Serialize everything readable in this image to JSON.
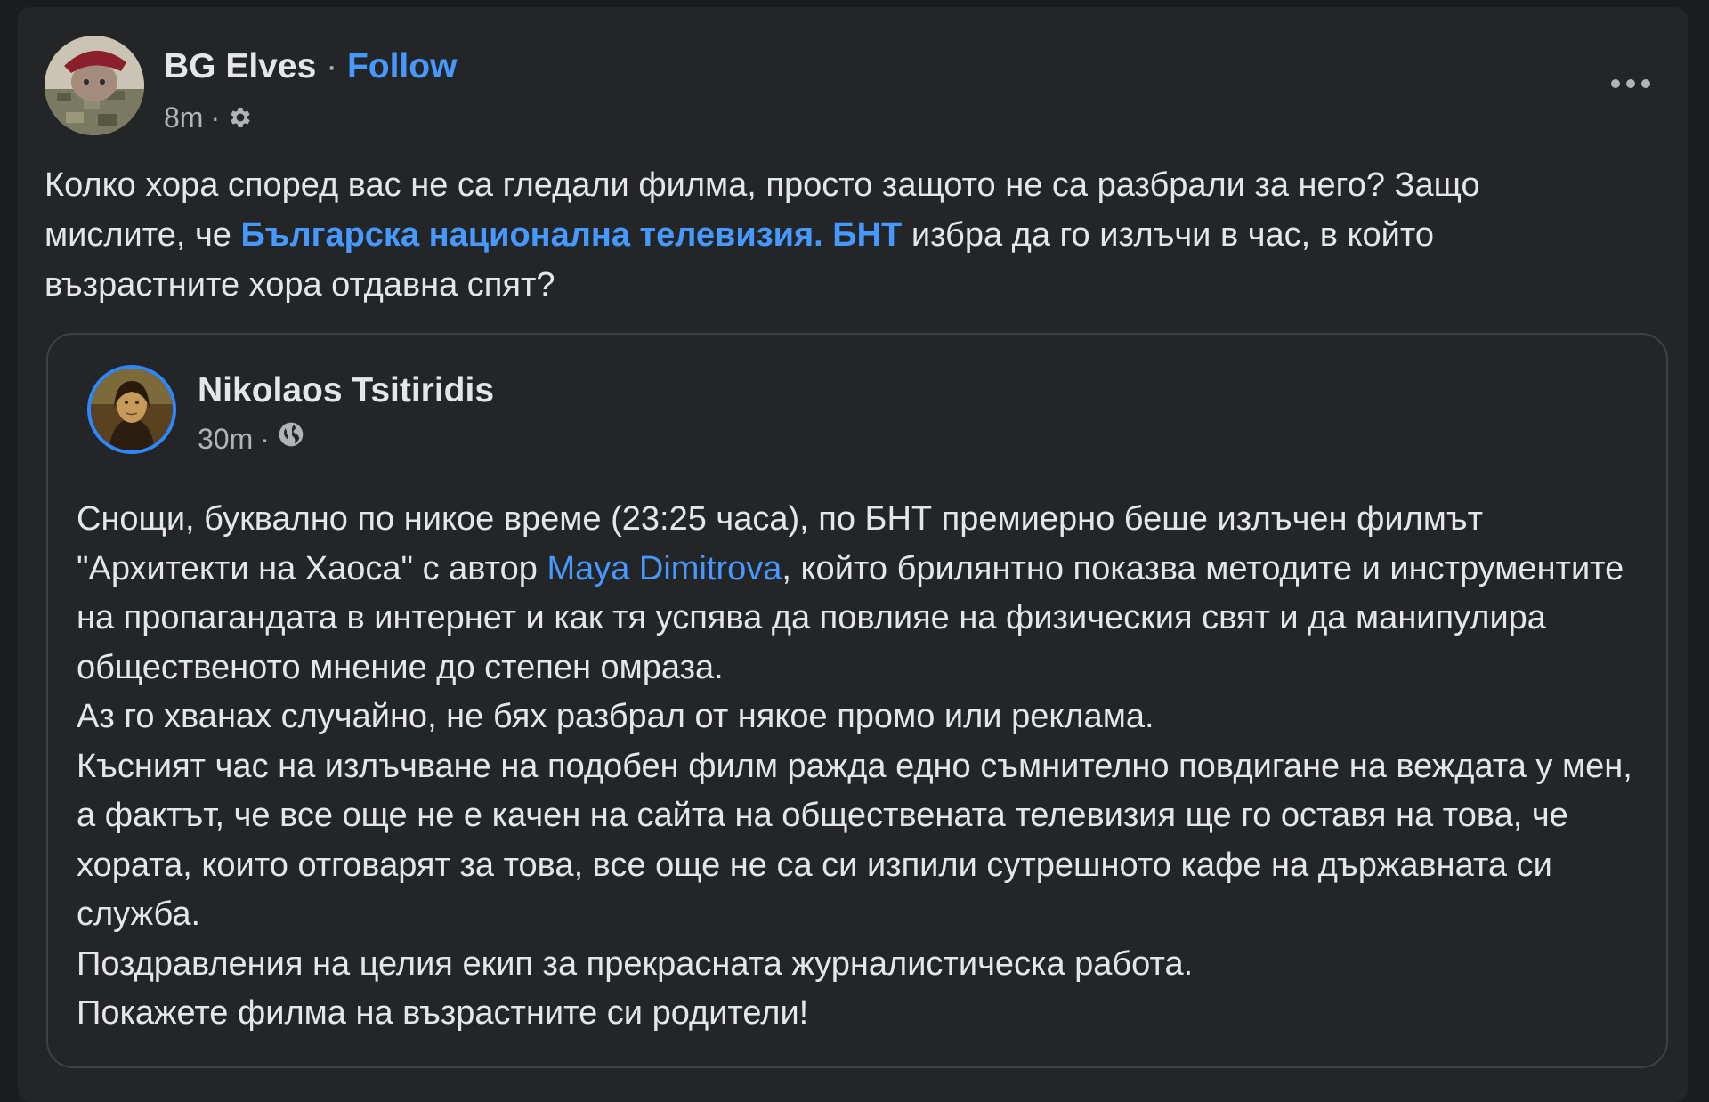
{
  "post": {
    "author": "BG Elves",
    "separator": "·",
    "follow_label": "Follow",
    "time": "8m",
    "meta_separator": "·",
    "privacy_icon": "gear-icon",
    "more_icon": "more-options-icon",
    "text_part1": "Колко хора според вас не са гледали филма, просто защото не са разбрали за него? Защо мислите, че ",
    "text_mention": "Българска национална телевизия. БНТ",
    "text_part2": "  избра да го излъчи в час, в който възрастните хора отдавна спят?"
  },
  "shared_post": {
    "author": "Nikolaos Tsitiridis",
    "time": "30m",
    "meta_separator": "·",
    "privacy_icon": "globe-icon",
    "p1_part1": "Снощи, буквално по никое време (23:25 часа), по БНТ премиерно беше излъчен филмът \"Архитекти на Хаоса\" с автор ",
    "p1_mention": "Maya Dimitrova",
    "p1_part2": ", който брилянтно показва методите и инструментите на пропагандата в интернет и как тя успява да повлияе на физическия свят и да манипулира общественото мнение до степен омраза.",
    "p2": "Аз го хванах случайно, не бях разбрал от някое промо или реклама.",
    "p3": "Късният час на излъчване на подобен филм ражда едно съмнително повдигане на веждата у мен, а фактът, че все още не е качен на сайта на обществената телевизия ще го оставя на това, че хората, които отговарят за това, все още не са си изпили сутрешното кафе на държавната си служба.",
    "p4": "Поздравления на целия екип за прекрасната журналистическа работа.",
    "p5": "Покажете филма на възрастните си родители!"
  },
  "colors": {
    "background": "#242526",
    "text": "#e4e6eb",
    "secondary_text": "#b0b3b8",
    "link": "#4599ff",
    "avatar_ring": "#2d88ff"
  }
}
